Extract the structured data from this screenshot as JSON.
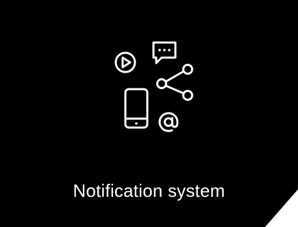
{
  "card": {
    "title": "Notification system",
    "background": "#000000",
    "foreground": "#ffffff"
  },
  "icons": [
    "play-circle-icon",
    "chat-bubble-icon",
    "share-icon",
    "smartphone-icon",
    "at-sign-icon"
  ]
}
